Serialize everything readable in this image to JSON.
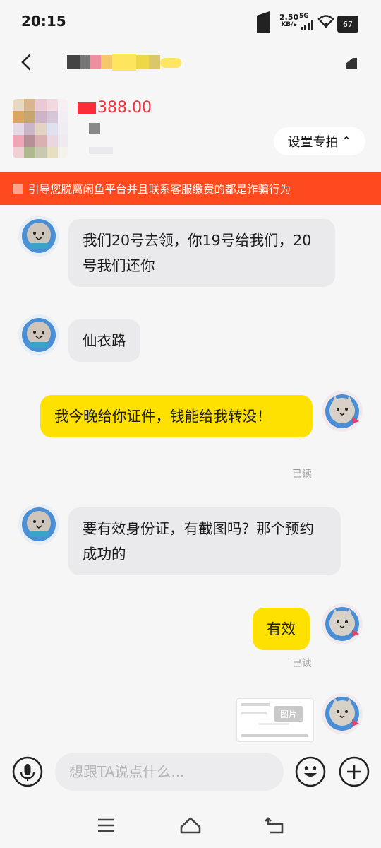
{
  "status_bar": {
    "time": "20:15",
    "net_speed": "2.50",
    "net_unit": "KB/s",
    "net_type": "5G",
    "battery": "67"
  },
  "header": {
    "title_blurred": "",
    "back_icon": "chevron-left-icon",
    "more_icon": "more-icon"
  },
  "product": {
    "price": "388.00",
    "settings_label": "设置专拍"
  },
  "warning": {
    "text": "引导您脱离闲鱼平台并且联系客服缴费的都是诈骗行为"
  },
  "messages": [
    {
      "side": "in",
      "text": "我们20号去领，你19号给我们，20号我们还你"
    },
    {
      "side": "in",
      "text": "仙衣路"
    },
    {
      "side": "out",
      "text": "我今晚给你证件，钱能给我转没！",
      "status": "已读"
    },
    {
      "side": "in",
      "text": "要有效身份证，有截图吗？那个预约成功的"
    },
    {
      "side": "out",
      "text": "有效",
      "status": "已读"
    },
    {
      "side": "out",
      "type": "image",
      "overlay_label": "图片"
    }
  ],
  "input": {
    "placeholder": "想跟TA说点什么..."
  },
  "colors": {
    "accent_yellow": "#ffe100",
    "warning_orange": "#ff4a1f",
    "price_red": "#ff2d3a"
  }
}
